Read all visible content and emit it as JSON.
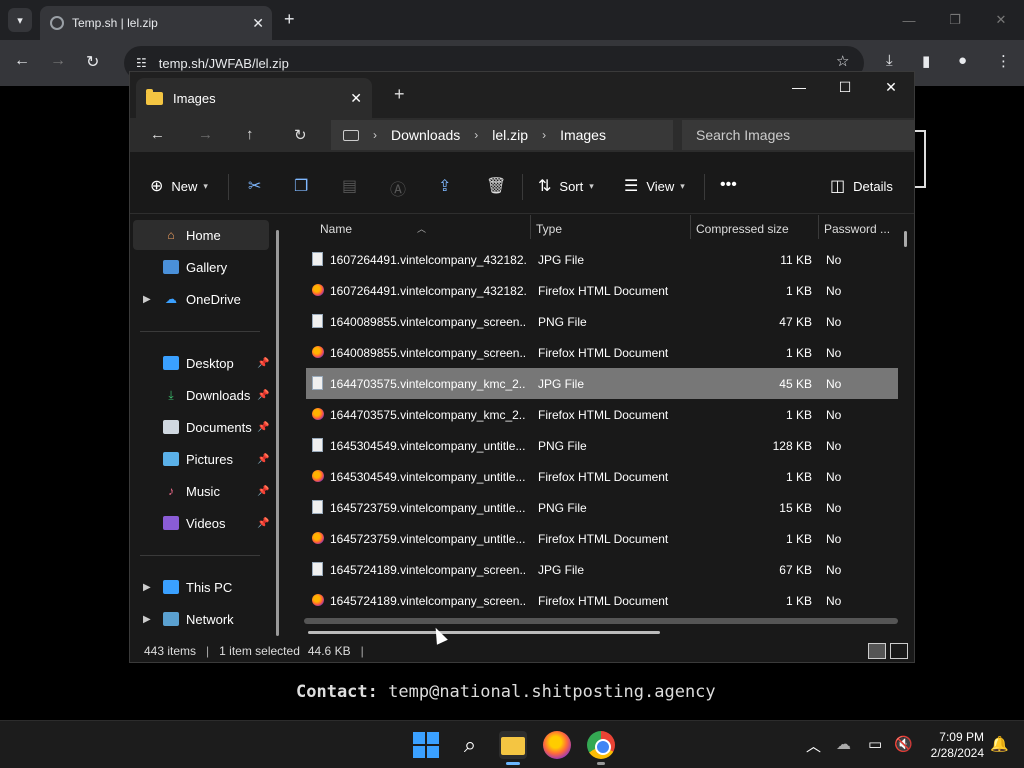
{
  "browser": {
    "tab_title": "Temp.sh | lel.zip",
    "url": "temp.sh/JWFAB/lel.zip"
  },
  "page": {
    "contact_label": "Contact:",
    "contact_email": "temp@national.shitposting.agency"
  },
  "explorer": {
    "tab_title": "Images",
    "breadcrumb": [
      "Downloads",
      "lel.zip",
      "Images"
    ],
    "search_placeholder": "Search Images",
    "commands": {
      "new": "New",
      "sort": "Sort",
      "view": "View",
      "details": "Details"
    },
    "sidebar": {
      "home": "Home",
      "gallery": "Gallery",
      "onedrive": "OneDrive",
      "desktop": "Desktop",
      "downloads": "Downloads",
      "documents": "Documents",
      "pictures": "Pictures",
      "music": "Music",
      "videos": "Videos",
      "thispc": "This PC",
      "network": "Network"
    },
    "columns": {
      "name": "Name",
      "type": "Type",
      "size": "Compressed size",
      "password": "Password ..."
    },
    "files": [
      {
        "name": "1607264491.vintelcompany_432182...",
        "type": "JPG File",
        "size": "11 KB",
        "pw": "No",
        "icon": "doc"
      },
      {
        "name": "1607264491.vintelcompany_432182...",
        "type": "Firefox HTML Document",
        "size": "1 KB",
        "pw": "No",
        "icon": "fx"
      },
      {
        "name": "1640089855.vintelcompany_screen...",
        "type": "PNG File",
        "size": "47 KB",
        "pw": "No",
        "icon": "doc"
      },
      {
        "name": "1640089855.vintelcompany_screen...",
        "type": "Firefox HTML Document",
        "size": "1 KB",
        "pw": "No",
        "icon": "fx"
      },
      {
        "name": "1644703575.vintelcompany_kmc_2...",
        "type": "JPG File",
        "size": "45 KB",
        "pw": "No",
        "icon": "doc",
        "selected": true
      },
      {
        "name": "1644703575.vintelcompany_kmc_2...",
        "type": "Firefox HTML Document",
        "size": "1 KB",
        "pw": "No",
        "icon": "fx"
      },
      {
        "name": "1645304549.vintelcompany_untitle...",
        "type": "PNG File",
        "size": "128 KB",
        "pw": "No",
        "icon": "doc"
      },
      {
        "name": "1645304549.vintelcompany_untitle...",
        "type": "Firefox HTML Document",
        "size": "1 KB",
        "pw": "No",
        "icon": "fx"
      },
      {
        "name": "1645723759.vintelcompany_untitle...",
        "type": "PNG File",
        "size": "15 KB",
        "pw": "No",
        "icon": "doc"
      },
      {
        "name": "1645723759.vintelcompany_untitle...",
        "type": "Firefox HTML Document",
        "size": "1 KB",
        "pw": "No",
        "icon": "fx"
      },
      {
        "name": "1645724189.vintelcompany_screen...",
        "type": "JPG File",
        "size": "67 KB",
        "pw": "No",
        "icon": "doc"
      },
      {
        "name": "1645724189.vintelcompany_screen...",
        "type": "Firefox HTML Document",
        "size": "1 KB",
        "pw": "No",
        "icon": "fx"
      }
    ],
    "status": {
      "count": "443 items",
      "selected": "1 item selected",
      "size": "44.6 KB"
    }
  },
  "taskbar": {
    "time": "7:09 PM",
    "date": "2/28/2024"
  },
  "colors": {
    "accent": "#3aa0ff",
    "folder": "#f4c542",
    "selection": "#777777"
  }
}
